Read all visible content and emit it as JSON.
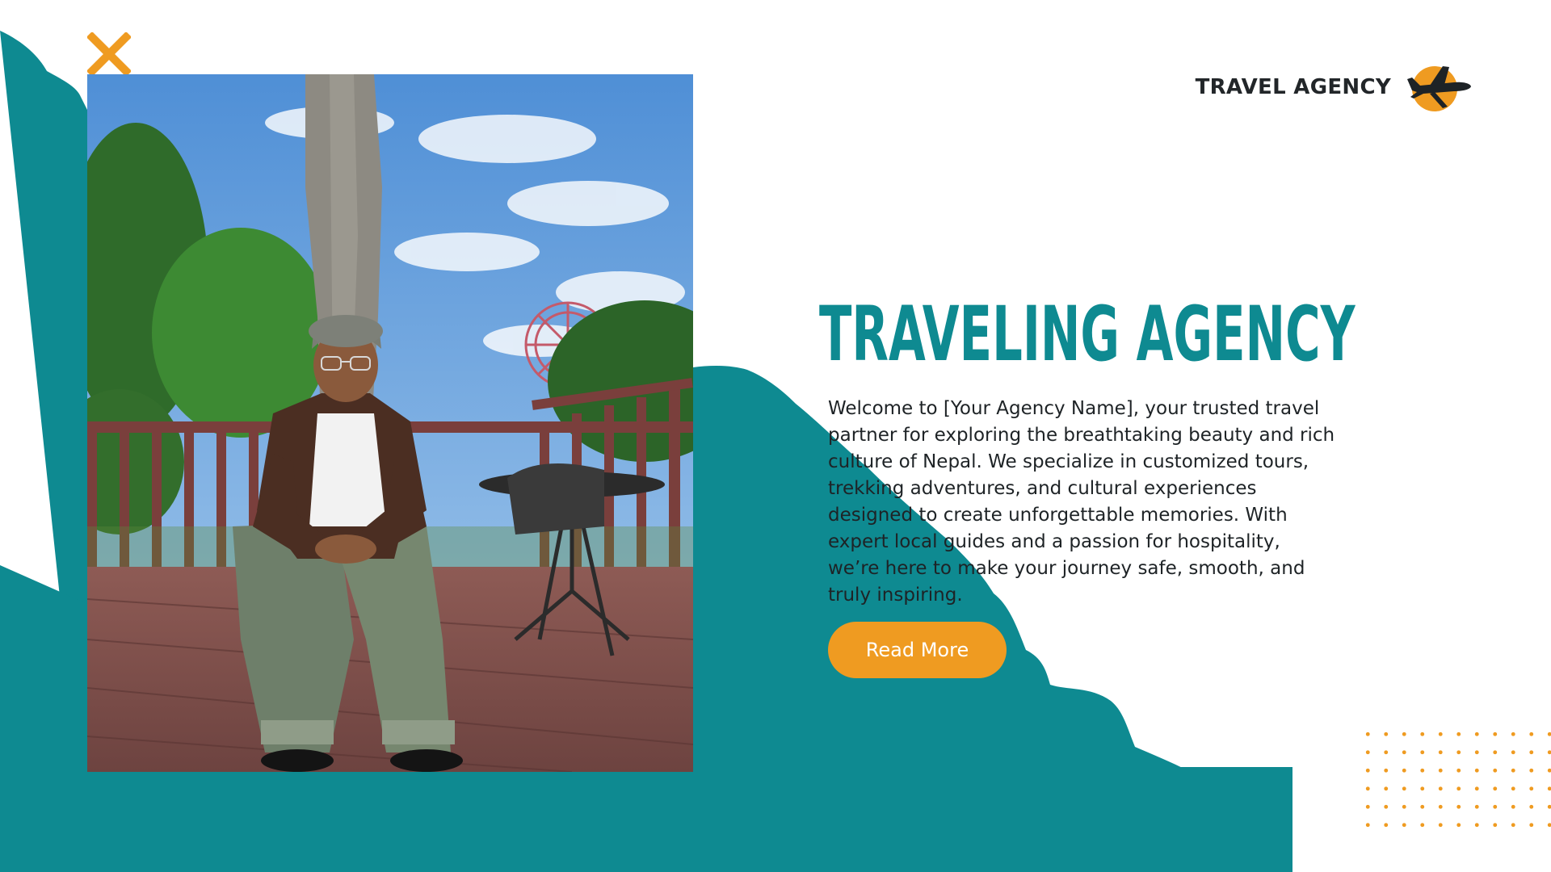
{
  "brand": {
    "label": "TRAVEL AGENCY",
    "icon": "airplane-icon"
  },
  "hero": {
    "title": "TRAVELING AGENCY",
    "body": "Welcome to [Your Agency Name], your trusted travel partner for exploring the breathtaking beauty and rich culture of Nepal. We specialize in customized tours, trekking adventures, and cultural experiences designed to create unforgettable memories. With expert local guides and a passion for hospitality, we’re here to make your journey safe, smooth, and truly inspiring.",
    "button_label": "Read More"
  },
  "decor": {
    "top_left_mark": "close-x-icon",
    "dot_grid": "dot-grid-pattern"
  },
  "colors": {
    "teal": "#0e8a91",
    "orange": "#ef9b21",
    "text_dark": "#1e2326"
  }
}
